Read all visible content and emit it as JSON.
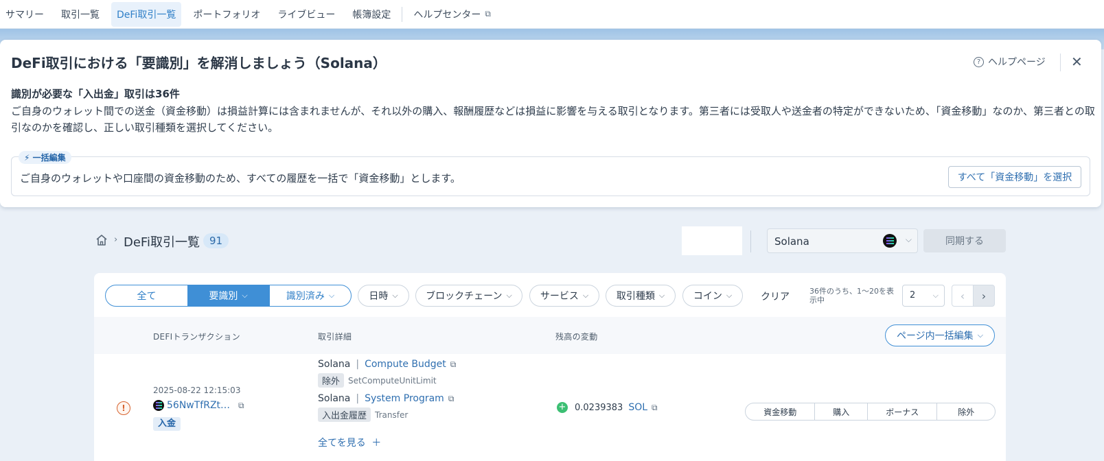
{
  "nav": {
    "items": [
      {
        "label": "サマリー",
        "active": false
      },
      {
        "label": "取引一覧",
        "active": false
      },
      {
        "label": "DeFi取引一覧",
        "active": true
      },
      {
        "label": "ポートフォリオ",
        "active": false
      },
      {
        "label": "ライブビュー",
        "active": false
      },
      {
        "label": "帳簿設定",
        "active": false
      }
    ],
    "help_center": "ヘルプセンター"
  },
  "notice": {
    "title": "DeFi取引における「要識別」を解消しましょう（Solana）",
    "help_page": "ヘルプページ",
    "subtitle": "識別が必要な「入出金」取引は36件",
    "body": "ご自身のウォレット間での送金（資金移動）は損益計算には含まれませんが、それ以外の購入、報酬履歴などは損益に影響を与える取引となります。第三者には受取人や送金者の特定ができないため、「資金移動」なのか、第三者との取引なのかを確認し、正しい取引種類を選択してください。",
    "bulk_tag": "一括編集",
    "bulk_text": "ご自身のウォレットや口座間の資金移動のため、すべての履歴を一括で「資金移動」とします。",
    "bulk_button": "すべて「資金移動」を選択"
  },
  "breadcrumb": {
    "title": "DeFi取引一覧",
    "count": "91"
  },
  "chain_select": {
    "value": "Solana"
  },
  "sync_button": "同期する",
  "filters": {
    "segments": [
      "全て",
      "要識別",
      "識別済み"
    ],
    "dropdowns": [
      "日時",
      "ブロックチェーン",
      "サービス",
      "取引種類",
      "コイン"
    ],
    "clear": "クリア",
    "page_info": "36件のうち、1〜20を表示中",
    "per_page": "2"
  },
  "table": {
    "headers": [
      "DEFIトランザクション",
      "取引詳細",
      "残高の変動"
    ],
    "page_bulk_button": "ページ内一括編集",
    "rows": [
      {
        "date": "2025-08-22 12:15:03",
        "hash": "56NwTfRZt…",
        "direction": "入金",
        "details": [
          {
            "chain": "Solana",
            "program": "Compute Budget",
            "tag": "除外",
            "method": "SetComputeUnitLimit"
          },
          {
            "chain": "Solana",
            "program": "System Program",
            "tag": "入出金履歴",
            "method": "Transfer"
          }
        ],
        "see_all": "全てを見る",
        "amount": "0.0239383",
        "coin": "SOL",
        "type_options": [
          "資金移動",
          "購入",
          "ボーナス",
          "除外"
        ]
      }
    ]
  },
  "colors": {
    "accent": "#3f8fd6",
    "link": "#2f6fb0",
    "warning": "#d6632f",
    "positive": "#3cbf73"
  }
}
